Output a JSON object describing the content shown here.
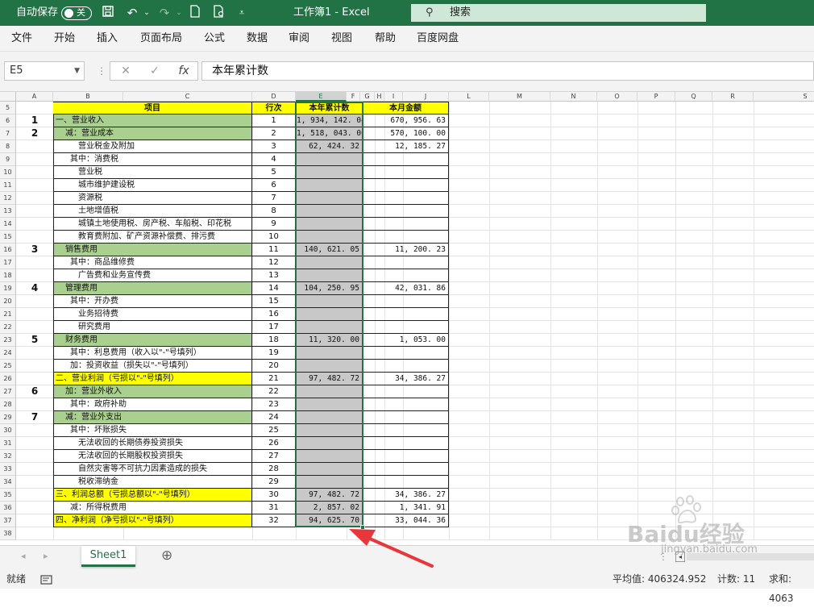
{
  "titlebar": {
    "autosave_label": "自动保存",
    "autosave_state": "关",
    "title": "工作簿1  -  Excel",
    "search_placeholder": "搜索"
  },
  "menu": [
    "文件",
    "开始",
    "插入",
    "页面布局",
    "公式",
    "数据",
    "审阅",
    "视图",
    "帮助",
    "百度网盘"
  ],
  "formula_bar": {
    "name_box": "E5",
    "fx": "fx",
    "content": "本年累计数"
  },
  "columns": [
    "A",
    "B",
    "C",
    "D",
    "E",
    "F",
    "G",
    "H",
    "I",
    "J",
    "L",
    "M",
    "N",
    "O",
    "P",
    "Q",
    "R",
    "S"
  ],
  "selected_column": "E",
  "table": {
    "headers": {
      "item": "项目",
      "line": "行次",
      "ytd": "本年累计数",
      "month": "本月金额"
    },
    "rows": [
      {
        "r": "6",
        "a": "1",
        "item": "一、营业收入",
        "line": "1",
        "ytd": "1, 934, 142. 04",
        "month": "670, 956. 63",
        "fill": "green"
      },
      {
        "r": "7",
        "a": "2",
        "item": "减：营业成本",
        "line": "2",
        "ytd": "1, 518, 043. 00",
        "month": "570, 100. 00",
        "fill": "green"
      },
      {
        "r": "8",
        "a": "",
        "item": "营业税金及附加",
        "line": "3",
        "ytd": "62, 424. 32",
        "month": "12, 185. 27",
        "fill": ""
      },
      {
        "r": "9",
        "a": "",
        "item": "其中：消费税",
        "line": "4",
        "ytd": "",
        "month": "",
        "fill": ""
      },
      {
        "r": "10",
        "a": "",
        "item": "营业税",
        "line": "5",
        "ytd": "",
        "month": "",
        "fill": ""
      },
      {
        "r": "11",
        "a": "",
        "item": "城市维护建设税",
        "line": "6",
        "ytd": "",
        "month": "",
        "fill": ""
      },
      {
        "r": "12",
        "a": "",
        "item": "资源税",
        "line": "7",
        "ytd": "",
        "month": "",
        "fill": ""
      },
      {
        "r": "13",
        "a": "",
        "item": "土地增值税",
        "line": "8",
        "ytd": "",
        "month": "",
        "fill": ""
      },
      {
        "r": "14",
        "a": "",
        "item": "城镇土地使用税、房产税、车船税、印花税",
        "line": "9",
        "ytd": "",
        "month": "",
        "fill": ""
      },
      {
        "r": "15",
        "a": "",
        "item": "教育费附加、矿产资源补偿费、排污费",
        "line": "10",
        "ytd": "",
        "month": "",
        "fill": ""
      },
      {
        "r": "16",
        "a": "3",
        "item": "销售费用",
        "line": "11",
        "ytd": "140, 621. 05",
        "month": "11, 200. 23",
        "fill": "green"
      },
      {
        "r": "17",
        "a": "",
        "item": "其中：商品维修费",
        "line": "12",
        "ytd": "",
        "month": "",
        "fill": ""
      },
      {
        "r": "18",
        "a": "",
        "item": "广告费和业务宣传费",
        "line": "13",
        "ytd": "",
        "month": "",
        "fill": ""
      },
      {
        "r": "19",
        "a": "4",
        "item": "管理费用",
        "line": "14",
        "ytd": "104, 250. 95",
        "month": "42, 031. 86",
        "fill": "green"
      },
      {
        "r": "20",
        "a": "",
        "item": "其中：开办费",
        "line": "15",
        "ytd": "",
        "month": "",
        "fill": ""
      },
      {
        "r": "21",
        "a": "",
        "item": "业务招待费",
        "line": "16",
        "ytd": "",
        "month": "",
        "fill": ""
      },
      {
        "r": "22",
        "a": "",
        "item": "研究费用",
        "line": "17",
        "ytd": "",
        "month": "",
        "fill": ""
      },
      {
        "r": "23",
        "a": "5",
        "item": "财务费用",
        "line": "18",
        "ytd": "11, 320. 00",
        "month": "1, 053. 00",
        "fill": "green"
      },
      {
        "r": "24",
        "a": "",
        "item": "其中：利息费用（收入以\"-\"号填列）",
        "line": "19",
        "ytd": "",
        "month": "",
        "fill": ""
      },
      {
        "r": "25",
        "a": "",
        "item": "加：投资收益（损失以\"-\"号填列）",
        "line": "20",
        "ytd": "",
        "month": "",
        "fill": ""
      },
      {
        "r": "26",
        "a": "",
        "item": "二、营业利润（亏损以\"-\"号填列）",
        "line": "21",
        "ytd": "97, 482. 72",
        "month": "34, 386. 27",
        "fill": "yellow"
      },
      {
        "r": "27",
        "a": "6",
        "item": "加：营业外收入",
        "line": "22",
        "ytd": "",
        "month": "",
        "fill": "green"
      },
      {
        "r": "28",
        "a": "",
        "item": "其中：政府补助",
        "line": "23",
        "ytd": "",
        "month": "",
        "fill": ""
      },
      {
        "r": "29",
        "a": "7",
        "item": "减：营业外支出",
        "line": "24",
        "ytd": "",
        "month": "",
        "fill": "green"
      },
      {
        "r": "30",
        "a": "",
        "item": "其中：坏账损失",
        "line": "25",
        "ytd": "",
        "month": "",
        "fill": ""
      },
      {
        "r": "31",
        "a": "",
        "item": "无法收回的长期债券投资损失",
        "line": "26",
        "ytd": "",
        "month": "",
        "fill": ""
      },
      {
        "r": "32",
        "a": "",
        "item": "无法收回的长期股权投资损失",
        "line": "27",
        "ytd": "",
        "month": "",
        "fill": ""
      },
      {
        "r": "33",
        "a": "",
        "item": "自然灾害等不可抗力因素造成的损失",
        "line": "28",
        "ytd": "",
        "month": "",
        "fill": ""
      },
      {
        "r": "34",
        "a": "",
        "item": "税收滞纳金",
        "line": "29",
        "ytd": "",
        "month": "",
        "fill": ""
      },
      {
        "r": "35",
        "a": "",
        "item": "三、利润总额（亏损总额以\"-\"号填列）",
        "line": "30",
        "ytd": "97, 482. 72",
        "month": "34, 386. 27",
        "fill": "yellow"
      },
      {
        "r": "36",
        "a": "",
        "item": "减：所得税费用",
        "line": "31",
        "ytd": "2, 857. 02",
        "month": "1, 341. 91",
        "fill": ""
      },
      {
        "r": "37",
        "a": "",
        "item": "四、净利润（净亏损以\"-\"号填列）",
        "line": "32",
        "ytd": "94, 625. 70",
        "month": "33, 044. 36",
        "fill": "yellow"
      }
    ],
    "extra_rows": [
      "38"
    ]
  },
  "sheet_tab": "Sheet1",
  "add_sheet": "⊕",
  "status": {
    "ready": "就绪",
    "average": "平均值: 406324.952",
    "count": "计数: 11",
    "sum": "求和: 4063"
  },
  "watermark": {
    "brand": "Baidu经验",
    "url": "jingyan.baidu.com"
  },
  "colors": {
    "excel_green": "#217346",
    "row_green": "#a9d08e",
    "row_yellow": "#ffff00",
    "selected_fill": "#c8c8c8",
    "arrow": "#e8363b"
  }
}
